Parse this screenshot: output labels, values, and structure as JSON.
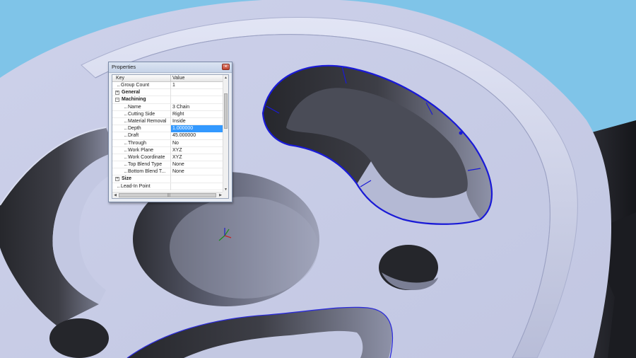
{
  "viewport": {
    "background_color": "#7fc4e8",
    "part_face_color": "#c8cde6",
    "wall_dark_color": "#2a2b30",
    "selection_color": "#1a1ad6"
  },
  "properties": {
    "title": "Properties",
    "close_glyph": "×",
    "columns": {
      "key": "Key",
      "value": "Value"
    },
    "rows": [
      {
        "key": "Group Count",
        "value": "1",
        "type": "item",
        "level": 0
      },
      {
        "key": "General",
        "value": "",
        "type": "group",
        "expand": "+"
      },
      {
        "key": "Machining",
        "value": "",
        "type": "group",
        "expand": "−"
      },
      {
        "key": "Name",
        "value": "3 Chain",
        "type": "item",
        "level": 1
      },
      {
        "key": "Cutting Side",
        "value": "Right",
        "type": "item",
        "level": 1
      },
      {
        "key": "Material Removal",
        "value": "Inside",
        "type": "item",
        "level": 1
      },
      {
        "key": "Depth",
        "value": "1.000000",
        "type": "item",
        "level": 1,
        "selected": true
      },
      {
        "key": "Draft",
        "value": "45.000000",
        "type": "item",
        "level": 1
      },
      {
        "key": "Through",
        "value": "No",
        "type": "item",
        "level": 1
      },
      {
        "key": "Work Plane",
        "value": "XYZ",
        "type": "item",
        "level": 1
      },
      {
        "key": "Work Coordinate",
        "value": "XYZ",
        "type": "item",
        "level": 1
      },
      {
        "key": "Top Blend Type",
        "value": "None",
        "type": "item",
        "level": 1
      },
      {
        "key": "Bottom Blend T...",
        "value": "None",
        "type": "item",
        "level": 1
      },
      {
        "key": "Size",
        "value": "",
        "type": "group",
        "expand": "+"
      },
      {
        "key": "Lead-In Point",
        "value": "",
        "type": "item",
        "level": 0
      }
    ],
    "scroll": {
      "up": "▲",
      "down": "▼",
      "left": "◀",
      "right": "▶",
      "grip": "|||"
    }
  }
}
